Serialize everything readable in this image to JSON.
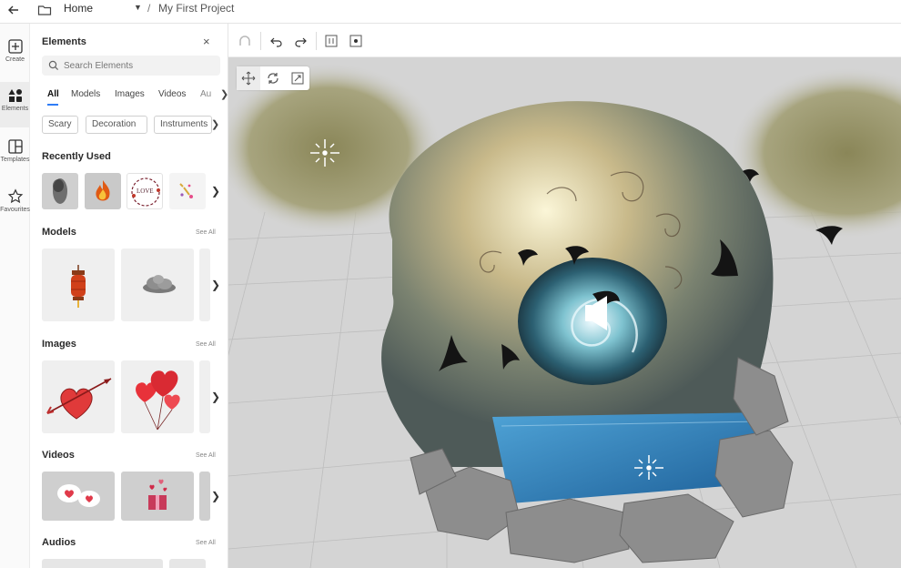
{
  "topbar": {
    "home_label": "Home",
    "separator": "/",
    "project_name": "My First Project"
  },
  "rail": {
    "items": [
      {
        "label": "Create",
        "icon": "plus-square-icon"
      },
      {
        "label": "Elements",
        "icon": "shapes-icon",
        "active": true
      },
      {
        "label": "Templates",
        "icon": "layout-icon"
      },
      {
        "label": "Favourites",
        "icon": "star-icon"
      }
    ]
  },
  "panel": {
    "title": "Elements",
    "close_glyph": "×",
    "search_placeholder": "Search Elements",
    "tabs": [
      "All",
      "Models",
      "Images",
      "Videos",
      "Au"
    ],
    "active_tab": "All",
    "chips": [
      "Scary",
      "Decoration",
      "Instruments"
    ],
    "sections": {
      "recently_used": {
        "title": "Recently Used"
      },
      "models": {
        "title": "Models",
        "see_all": "See All"
      },
      "images": {
        "title": "Images",
        "see_all": "See All"
      },
      "videos": {
        "title": "Videos",
        "see_all": "See All"
      },
      "audios": {
        "title": "Audios",
        "see_all": "See All"
      }
    },
    "recent_love_text": "LOVE"
  },
  "toolbar": {
    "icons": [
      "magnet-icon",
      "undo-icon",
      "redo-icon",
      "frame-icon",
      "center-icon"
    ]
  },
  "gizmo": {
    "icons": [
      "move-icon",
      "rotate-icon",
      "scale-icon"
    ],
    "active": "move-icon"
  },
  "colors": {
    "accent": "#2f7df6",
    "canvas_bg": "#d4d4d4",
    "water": "#2d7fb8"
  }
}
